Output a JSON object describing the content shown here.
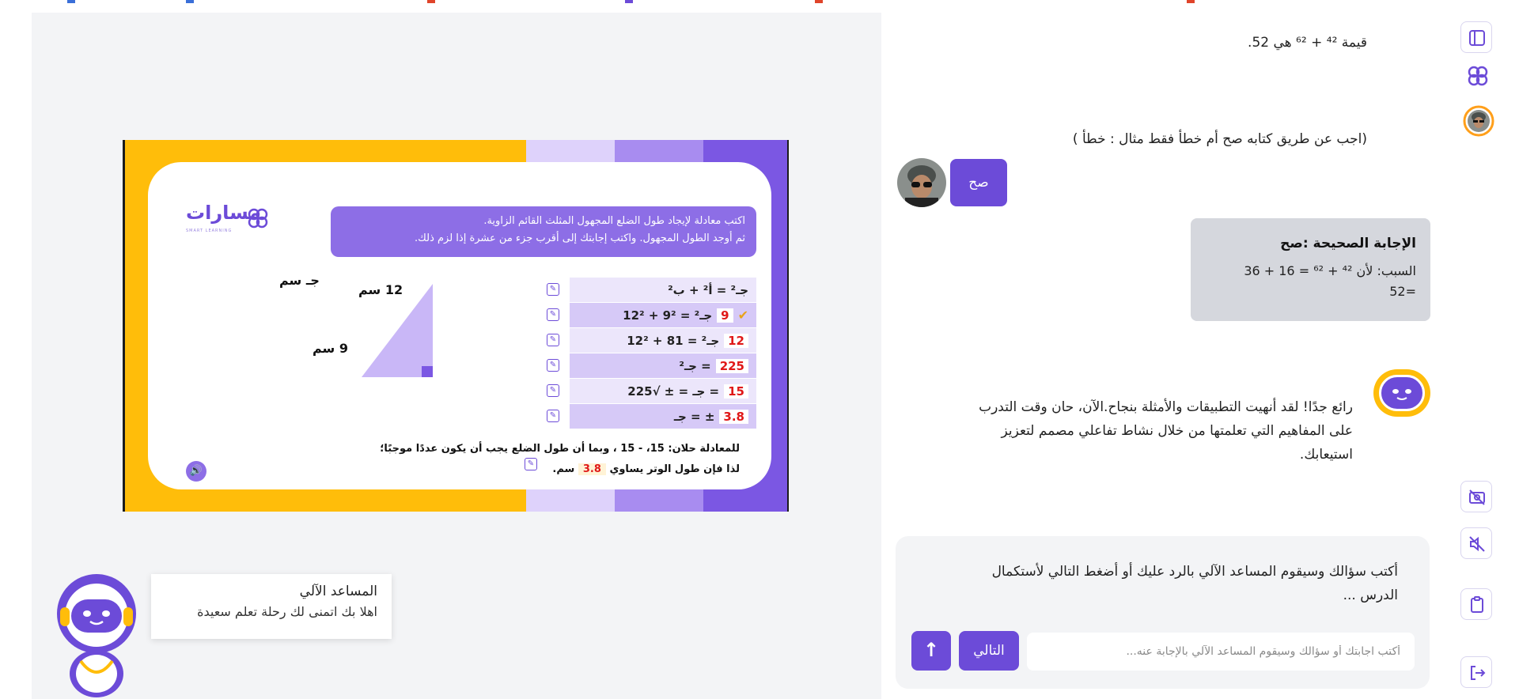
{
  "colors": {
    "accent": "#6c4bd8",
    "accent_light": "#8d6ee6",
    "yellow": "#ffbd0a",
    "red": "#e01818"
  },
  "slide": {
    "logo": {
      "name": "مسارات",
      "sub": "SMART LEARNING"
    },
    "instruction_line1": "اكتب معادلة لإيجاد طول الضلع المجهول المثلث القائم الزاوية.",
    "instruction_line2": "ثم أوجد الطول المجهول. واكتب إجابتك إلى أقرب جزء من عشرة إذا لزم ذلك.",
    "triangle_labels": {
      "hyp": "جـ سم",
      "vertical": "12 سم",
      "base": "9 سم"
    },
    "steps": [
      {
        "text": "جـ² = أ² + ب²",
        "red": ""
      },
      {
        "text": "جـ² = 9² + 12²",
        "red": "9"
      },
      {
        "text": "جـ² = 81 + 12²",
        "red": "12"
      },
      {
        "text": "جـ² =",
        "red": "225"
      },
      {
        "text": "جـ = ± √225 =",
        "red": "15"
      },
      {
        "text": "جـ = ±",
        "red": "3.8"
      }
    ],
    "conclusion_line1": "للمعادلة حلان: 15، - 15 ، وبما أن طول الضلع يجب أن يكون عددًا موجبًا؛",
    "conclusion_line2_before": "لذا فإن طول الوتر يساوي",
    "conclusion_value": "3.8",
    "conclusion_line2_after": "سم."
  },
  "assistant_tip": {
    "title": "المساعد الآلي",
    "text": "اهلا بك اتمنى لك رحلة تعلم سعيدة"
  },
  "chat": {
    "msg_value": "قيمة ⁴² + ⁶² هي 52.",
    "msg_instruction": "(اجب عن طريق كتابه صح أم خطأ فقط مثال : خطأ )",
    "user_reply": "صح",
    "answer_title": "الإجابة الصحيحة :صح",
    "answer_reason_line1": "السبب: لأن ⁴² + ⁶² = 16 + 36",
    "answer_reason_line2": "=52",
    "bot_message": "رائع جدًا! لقد أنهيت التطبيقات والأمثلة بنجاح.الآن، حان وقت التدرب على المفاهيم التي تعلمتها من خلال نشاط تفاعلي مصمم لتعزيز استيعابك.",
    "prompt": "أكتب سؤالك وسيقوم المساعد الآلي بالرد عليك أو أضغط التالي لأستكمال الدرس ...",
    "next_label": "التالي",
    "input_placeholder": "أكتب اجابتك أو سؤالك وسيقوم المساعد الآلي بالإجابة عنه..."
  },
  "rail_icons": [
    "sidebar-toggle-icon",
    "logo-icon",
    "profile-icon",
    "camera-off-icon",
    "volume-off-icon",
    "clipboard-icon",
    "logout-icon"
  ]
}
